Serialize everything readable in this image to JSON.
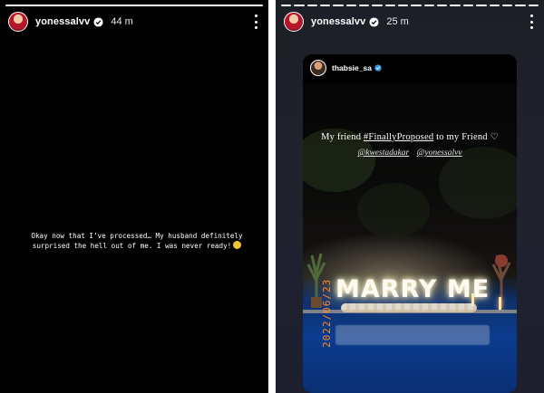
{
  "left_story": {
    "username": "yonessalvv",
    "time": "44 m",
    "progress": 1.0,
    "text": "Okay now that I’ve processed… My husband definitely surprised the hell out of me. I was never ready!",
    "emoji_icon": "grinning-face-icon"
  },
  "right_story": {
    "username": "yonessalvv",
    "time": "25 m",
    "segments_total": 20,
    "segments_done": 20,
    "reshared_post": {
      "username": "thabsie_sa",
      "caption_prefix": "My friend ",
      "hashtag": "#FinallyProposed",
      "caption_suffix": " to my Friend",
      "heart_icon": "white-heart-icon",
      "mentions": [
        "@kwestadakar",
        "@yonessalvv"
      ],
      "sign_text": "MARRY ME",
      "date_stamp": "2022/06/23"
    }
  },
  "colors": {
    "left_bg": "#000000",
    "right_bg": "#1e2030",
    "pool_blue": "#0b3c8f",
    "date_orange": "#ff8c2a"
  }
}
